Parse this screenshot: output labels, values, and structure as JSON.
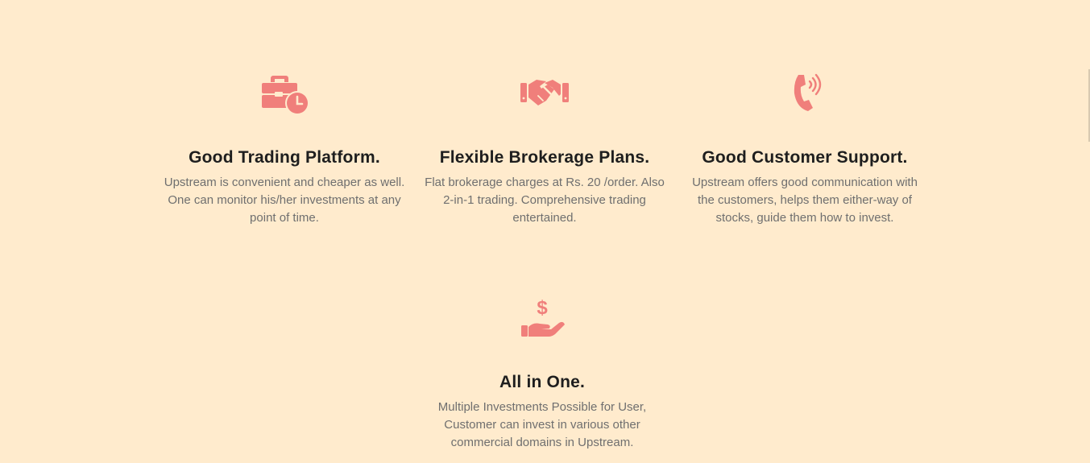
{
  "colors": {
    "background": "#FFEBCD",
    "accent": "#F07F7B",
    "heading": "#1E1E1E",
    "body_text": "#6F6F6F"
  },
  "features": [
    {
      "icon": "briefcase-clock-icon",
      "title": "Good Trading Platform.",
      "description": "Upstream is convenient and cheaper as well. One can monitor his/her investments at any point of time."
    },
    {
      "icon": "handshake-icon",
      "title": "Flexible Brokerage Plans.",
      "description": "Flat brokerage charges at Rs. 20 /order. Also 2-in-1 trading. Comprehensive trading entertained."
    },
    {
      "icon": "phone-volume-icon",
      "title": "Good Customer Support.",
      "description": "Upstream offers good communication with the customers, helps them either-way of stocks, guide them how to invest."
    },
    {
      "icon": "hand-holding-dollar-icon",
      "title": "All in One.",
      "description": "Multiple Investments Possible for User, Customer can invest in various other commercial domains in Upstream."
    }
  ]
}
